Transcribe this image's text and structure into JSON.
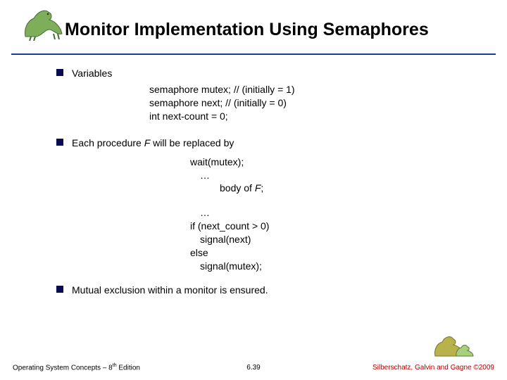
{
  "title": "Monitor Implementation Using Semaphores",
  "bullets": {
    "b1": "Variables",
    "b2_pre": "Each procedure ",
    "b2_f": "F",
    "b2_post": "  will be replaced by",
    "b3": "Mutual exclusion within a monitor is ensured."
  },
  "code1": {
    "l1": "semaphore mutex;  // (initially  = 1)",
    "l2": "semaphore next;     // (initially  = 0)",
    "l3": "int next-count = 0;"
  },
  "code2": {
    "l1": "wait(mutex);",
    "l2": "…",
    "body_pre": "body of ",
    "body_f": "F",
    "body_post": ";",
    "l4": "…",
    "l5": "if (next_count > 0)",
    "l6": "signal(next)",
    "l7": "else",
    "l8": "signal(mutex);"
  },
  "footer": {
    "left_pre": "Operating System Concepts – 8",
    "left_sup": "th",
    "left_post": " Edition",
    "center": "6.39",
    "right": "Silberschatz, Galvin and Gagne ©2009"
  },
  "icons": {
    "dino_top": "dinosaur-icon",
    "dino_bottom": "dinosaur-family-icon"
  }
}
